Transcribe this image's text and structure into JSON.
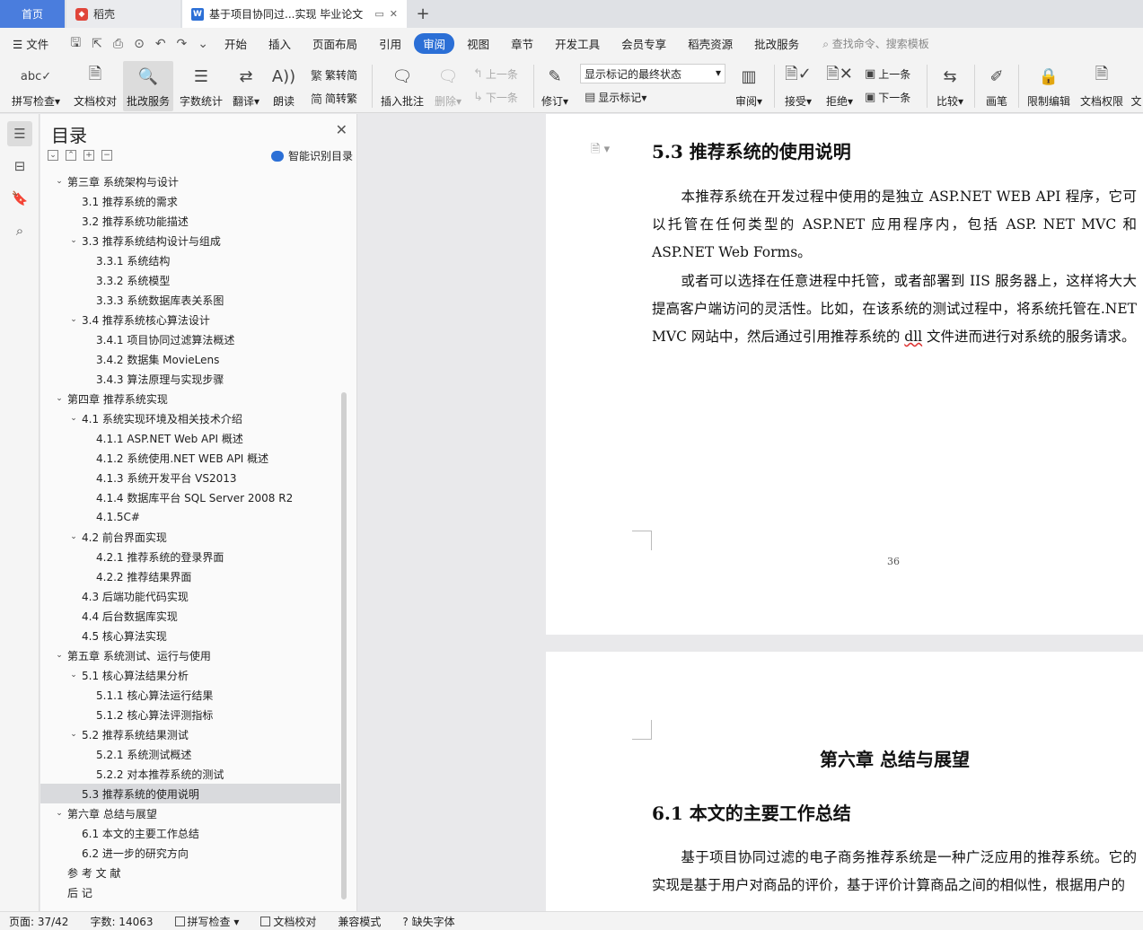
{
  "tabs": {
    "home": "首页",
    "daoke": "稻壳",
    "doc": "基于项目协同过...实现 毕业论文",
    "add": "+"
  },
  "menu": {
    "file": "文件",
    "items": [
      "开始",
      "插入",
      "页面布局",
      "引用",
      "审阅",
      "视图",
      "章节",
      "开发工具",
      "会员专享",
      "稻壳资源",
      "批改服务"
    ],
    "active": "审阅",
    "search": "查找命令、搜索模板"
  },
  "ribbon": {
    "spell": "拼写检查",
    "doc_check": "文档校对",
    "review_service": "批改服务",
    "word_count": "字数统计",
    "translate": "翻译",
    "read": "朗读",
    "trad_to_simp": "繁转简",
    "simp_to_trad": "简转繁",
    "insert_comment": "插入批注",
    "delete": "删除",
    "prev_comment": "上一条",
    "next_comment": "下一条",
    "revise": "修订",
    "markup_state": "显示标记的最终状态",
    "show_markup": "显示标记",
    "review": "审阅",
    "accept": "接受",
    "reject": "拒绝",
    "prev_change": "上一条",
    "next_change": "下一条",
    "compare": "比较",
    "pen": "画笔",
    "restrict_edit": "限制编辑",
    "doc_rights": "文档权限",
    "more": "文"
  },
  "toc": {
    "title": "目录",
    "smart": "智能识别目录",
    "items": [
      {
        "text": "第三章  系统架构与设计",
        "level": 0,
        "arrow": "v"
      },
      {
        "text": "3.1 推荐系统的需求",
        "level": 1,
        "arrow": ""
      },
      {
        "text": "3.2 推荐系统功能描述",
        "level": 1,
        "arrow": ""
      },
      {
        "text": "3.3  推荐系统结构设计与组成",
        "level": 1,
        "arrow": "v"
      },
      {
        "text": "3.3.1  系统结构",
        "level": 2,
        "arrow": ""
      },
      {
        "text": "3.3.2  系统模型",
        "level": 2,
        "arrow": ""
      },
      {
        "text": "3.3.3  系统数据库表关系图",
        "level": 2,
        "arrow": ""
      },
      {
        "text": "3.4  推荐系统核心算法设计",
        "level": 1,
        "arrow": "v"
      },
      {
        "text": "3.4.1  项目协同过滤算法概述",
        "level": 2,
        "arrow": ""
      },
      {
        "text": "3.4.2 数据集 MovieLens",
        "level": 2,
        "arrow": ""
      },
      {
        "text": "3.4.3 算法原理与实现步骤",
        "level": 2,
        "arrow": ""
      },
      {
        "text": "第四章  推荐系统实现",
        "level": 0,
        "arrow": "v"
      },
      {
        "text": "4.1  系统实现环境及相关技术介绍",
        "level": 1,
        "arrow": "v"
      },
      {
        "text": "4.1.1 ASP.NET Web API 概述",
        "level": 2,
        "arrow": ""
      },
      {
        "text": "4.1.2  系统使用.NET    WEB API 概述",
        "level": 2,
        "arrow": ""
      },
      {
        "text": "4.1.3 系统开发平台  VS2013",
        "level": 2,
        "arrow": ""
      },
      {
        "text": "4.1.4 数据库平台  SQL Server 2008 R2",
        "level": 2,
        "arrow": ""
      },
      {
        "text": "4.1.5C#",
        "level": 2,
        "arrow": ""
      },
      {
        "text": "4.2 前台界面实现",
        "level": 1,
        "arrow": "v"
      },
      {
        "text": "4.2.1  推荐系统的登录界面",
        "level": 2,
        "arrow": ""
      },
      {
        "text": "4.2.2  推荐结果界面",
        "level": 2,
        "arrow": ""
      },
      {
        "text": "4.3  后端功能代码实现",
        "level": 1,
        "arrow": ""
      },
      {
        "text": "4.4 后台数据库实现",
        "level": 1,
        "arrow": ""
      },
      {
        "text": "4.5  核心算法实现",
        "level": 1,
        "arrow": ""
      },
      {
        "text": "第五章  系统测试、运行与使用",
        "level": 0,
        "arrow": "v"
      },
      {
        "text": "5.1 核心算法结果分析",
        "level": 1,
        "arrow": "v"
      },
      {
        "text": "5.1.1 核心算法运行结果",
        "level": 2,
        "arrow": ""
      },
      {
        "text": "5.1.2 核心算法评测指标",
        "level": 2,
        "arrow": ""
      },
      {
        "text": "5.2  推荐系统结果测试",
        "level": 1,
        "arrow": "v"
      },
      {
        "text": "5.2.1  系统测试概述",
        "level": 2,
        "arrow": ""
      },
      {
        "text": "5.2.2  对本推荐系统的测试",
        "level": 2,
        "arrow": ""
      },
      {
        "text": "5.3  推荐系统的使用说明",
        "level": 1,
        "arrow": "",
        "selected": true
      },
      {
        "text": "第六章  总结与展望",
        "level": 0,
        "arrow": "v"
      },
      {
        "text": "6.1  本文的主要工作总结",
        "level": 1,
        "arrow": ""
      },
      {
        "text": "6.2  进一步的研究方向",
        "level": 1,
        "arrow": ""
      },
      {
        "text": "参 考 文 献",
        "level": 0,
        "arrow": ""
      },
      {
        "text": "后    记",
        "level": 0,
        "arrow": ""
      }
    ]
  },
  "doc": {
    "section_53": "5.3  推荐系统的使用说明",
    "para1": "本推荐系统在开发过程中使用的是独立 ASP.NET WEB API 程序，它可以托管在任何类型的 ASP.NET  应用程序内，包括 ASP. NET MVC 和 ASP.NET Web Forms。",
    "para2_a": "或者可以选择在任意进程中托管，或者部署到 IIS 服务器上，这样将大大提高客户端访问的灵活性。比如，在该系统的测试过程中，将系统托管在.NET MVC 网站中，然后通过引用推荐系统的 ",
    "para2_dll": "dll",
    "para2_b": " 文件进而进行对系统的服务请求。",
    "page_number": "36",
    "chapter6": "第六章  总结与展望",
    "section_61": "6.1  本文的主要工作总结",
    "para3": "基于项目协同过滤的电子商务推荐系统是一种广泛应用的推荐系统。它的实现是基于用户对商品的评价，基于评价计算商品之间的相似性，根据用户的"
  },
  "status": {
    "page": "页面: 37/42",
    "words": "字数: 14063",
    "spell": "拼写检查",
    "proof": "文档校对",
    "compat": "兼容模式",
    "missing_font": "缺失字体"
  }
}
